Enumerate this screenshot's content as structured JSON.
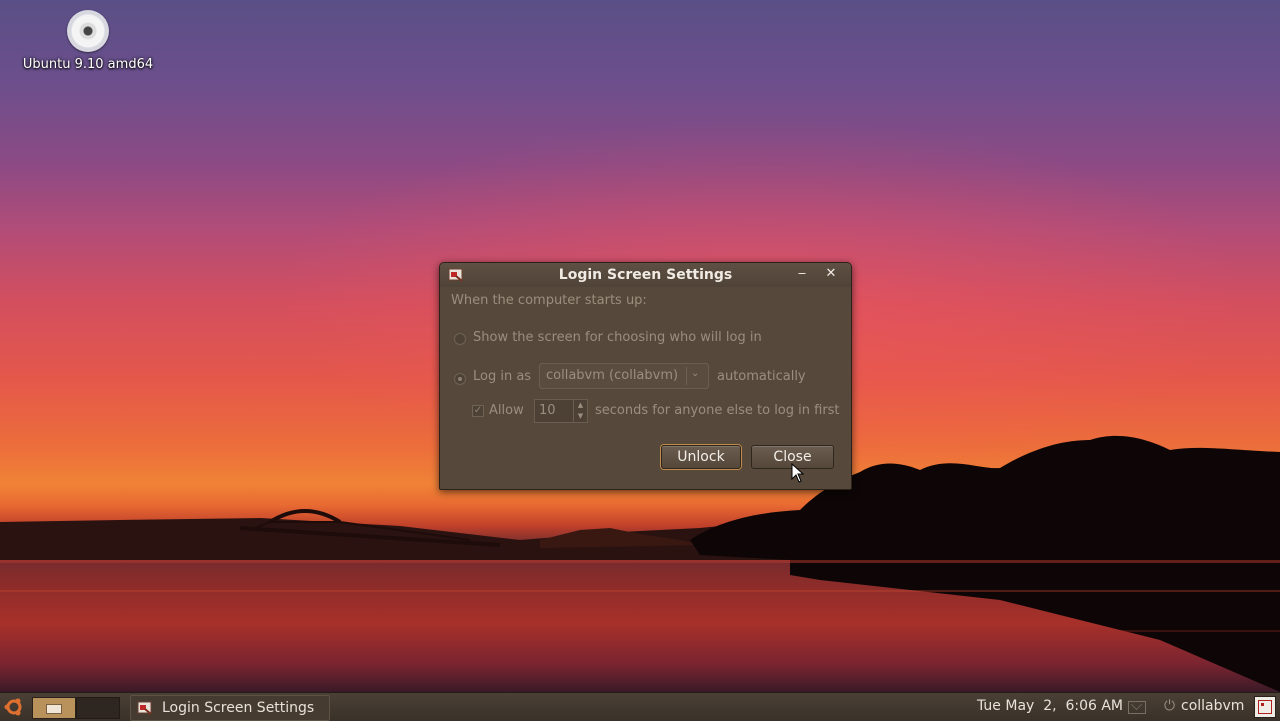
{
  "desktop": {
    "icons": [
      {
        "label": "Ubuntu 9.10 amd64",
        "icon": "cd-icon"
      }
    ]
  },
  "dialog": {
    "title": "Login Screen Settings",
    "section_label": "When the computer starts up:",
    "option_choose": "Show the screen for choosing who will log in",
    "option_login_as": "Log in as",
    "user_select": "collabvm (collabvm)",
    "automatically": "automatically",
    "allow_label": "Allow",
    "delay_value": "10",
    "delay_suffix": "seconds for anyone else to log in first",
    "unlock_label": "Unlock",
    "close_label": "Close",
    "selected_option": "login_as",
    "allow_checked": true
  },
  "taskbar": {
    "task_title": "Login Screen Settings",
    "clock": "Tue May  2,  6:06 AM",
    "user": "collabvm"
  }
}
